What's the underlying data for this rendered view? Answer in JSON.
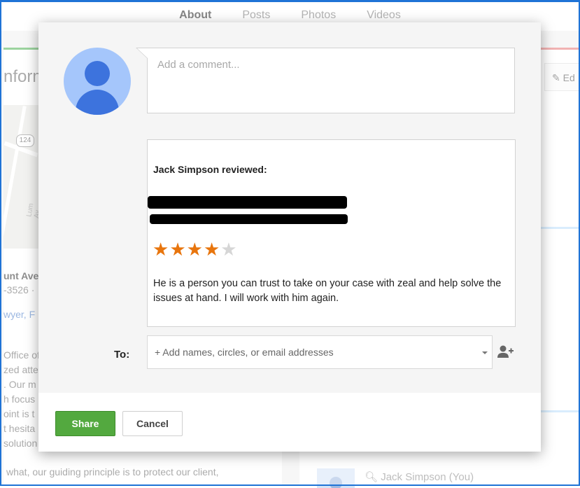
{
  "background": {
    "tabs": [
      {
        "label": "About",
        "active": true
      },
      {
        "label": "Posts",
        "active": false
      },
      {
        "label": "Photos",
        "active": false
      },
      {
        "label": "Videos",
        "active": false
      }
    ],
    "section_title": "nform",
    "map_route_number": "124",
    "map_street_label": "Lum Av",
    "address_fragment": "unt Ave",
    "phone_fragment": "-3526 ·",
    "categories_fragment": "wyer, F",
    "description_lines": [
      "Office of",
      "zed atte",
      ". Our m",
      "h focus",
      "oint is t",
      "t hesita",
      "solution"
    ],
    "description_last_line": "what, our guiding principle is to protect our client,",
    "edit_label": "Ed",
    "current_user": "Jack Simpson (You)"
  },
  "dialog": {
    "comment": {
      "placeholder": "Add a comment...",
      "value": ""
    },
    "review": {
      "author_line": "Jack Simpson reviewed:",
      "rating": 4,
      "rating_max": 5,
      "text": "He is a person you can trust to take on your case with zeal and help solve the issues at hand. I will work with him again."
    },
    "to": {
      "label": "To:",
      "placeholder": "+ Add names, circles, or email addresses",
      "value": ""
    },
    "buttons": {
      "share": "Share",
      "cancel": "Cancel"
    },
    "colors": {
      "share_button": "#53a93f",
      "star_on": "#e8750d",
      "star_off": "#d6d6d6",
      "avatar_bg": "#a5c6fb",
      "avatar_fg": "#3d73dd"
    },
    "icons": {
      "avatar": "default-user-avatar-icon",
      "add_person": "add-person-icon",
      "dropdown": "caret-down-icon",
      "star": "star-icon"
    }
  }
}
